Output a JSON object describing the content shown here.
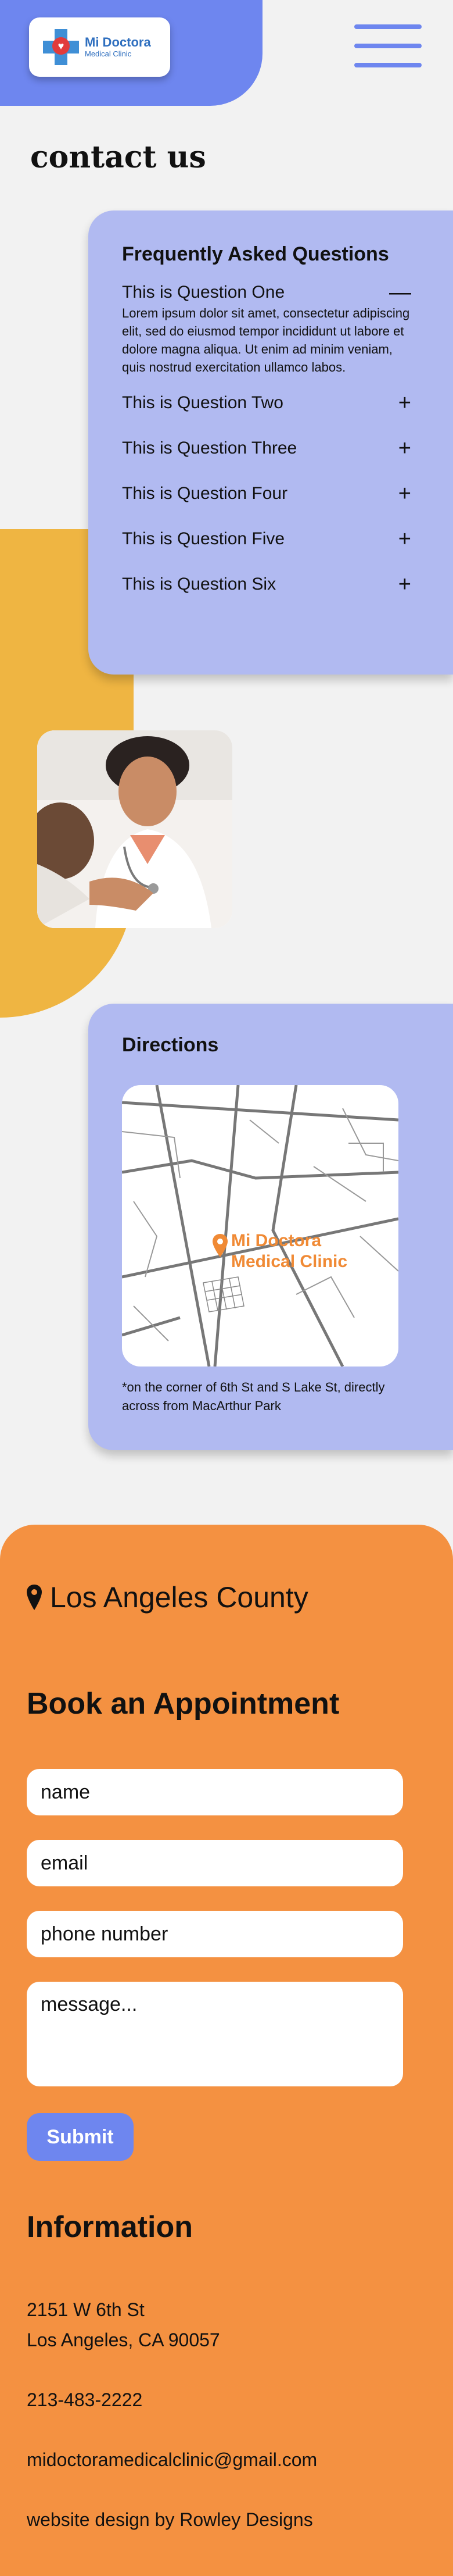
{
  "header": {
    "logo_name": "Mi Doctora",
    "logo_sub": "Medical Clinic"
  },
  "page_title": "contact us",
  "faq": {
    "title": "Frequently Asked Questions",
    "items": [
      {
        "question": "This is Question One",
        "toggle": "—",
        "answer": "Lorem ipsum dolor sit amet, consectetur adipiscing elit, sed do eiusmod tempor incididunt ut labore et dolore magna aliqua. Ut enim ad minim veniam, quis nostrud exercitation ullamco labos."
      },
      {
        "question": "This is Question Two",
        "toggle": "+"
      },
      {
        "question": "This is Question Three",
        "toggle": "+"
      },
      {
        "question": "This is Question Four",
        "toggle": "+"
      },
      {
        "question": "This is Question Five",
        "toggle": "+"
      },
      {
        "question": "This is Question Six",
        "toggle": "+"
      }
    ]
  },
  "directions": {
    "title": "Directions",
    "map_label_line1": "Mi Doctora",
    "map_label_line2": "Medical Clinic",
    "note": "*on the corner of 6th St and S Lake St, directly across from MacArthur Park"
  },
  "footer": {
    "location": "Los Angeles County",
    "book_title": "Book an Appointment",
    "form": {
      "name_placeholder": "name",
      "email_placeholder": "email",
      "phone_placeholder": "phone number",
      "message_placeholder": "message...",
      "submit_label": "Submit"
    },
    "info_title": "Information",
    "address_line1": "2151 W 6th St",
    "address_line2": "Los Angeles, CA 90057",
    "phone": "213-483-2222",
    "email": "midoctoramedicalclinic@gmail.com",
    "credit": "website design by Rowley Designs"
  },
  "colors": {
    "primary_blue": "#6e86ef",
    "card_lavender": "#b1baf1",
    "accent_yellow": "#efb542",
    "footer_orange": "#f49141"
  }
}
